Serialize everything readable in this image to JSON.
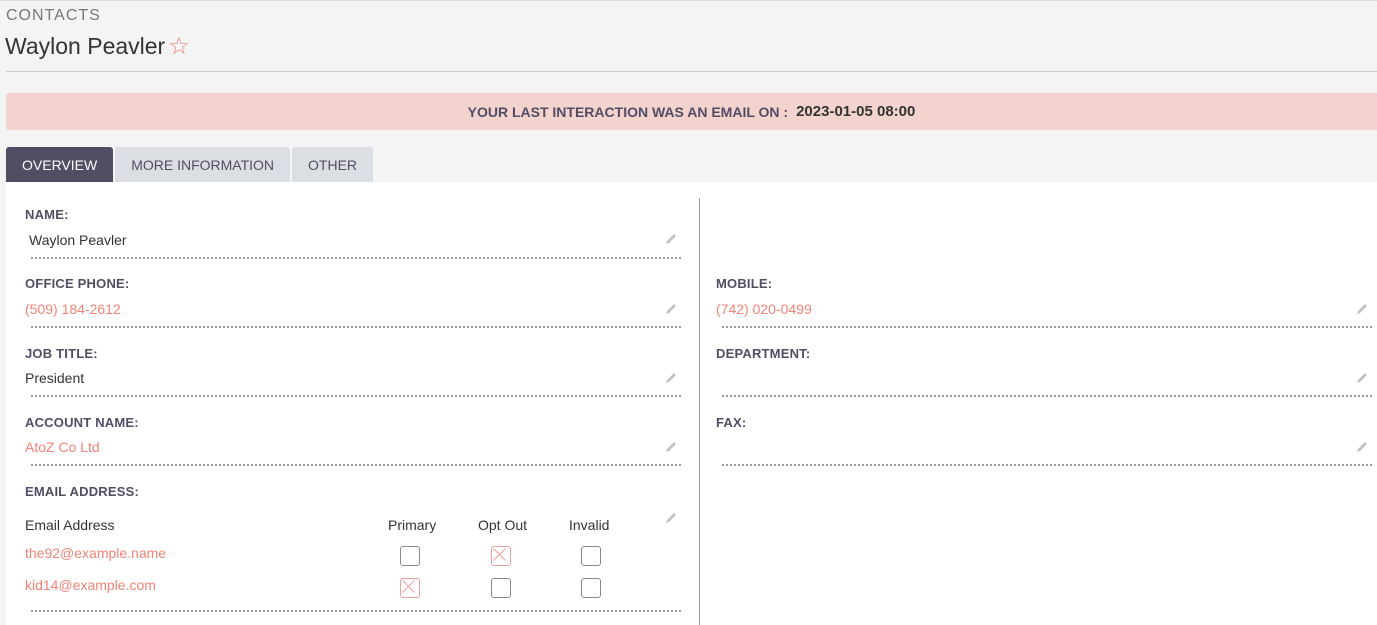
{
  "header": {
    "module": "CONTACTS",
    "record_name": "Waylon Peavler",
    "favorite_icon": "star-outline-icon"
  },
  "banner": {
    "text": "YOUR LAST INTERACTION WAS AN EMAIL ON :",
    "timestamp": "2023-01-05 08:00"
  },
  "tabs": [
    {
      "label": "OVERVIEW",
      "active": true
    },
    {
      "label": "MORE INFORMATION",
      "active": false
    },
    {
      "label": "OTHER",
      "active": false
    }
  ],
  "fields": {
    "name": {
      "label": "NAME:",
      "value": "Waylon Peavler"
    },
    "office_phone": {
      "label": "OFFICE PHONE:",
      "value": "(509) 184-2612"
    },
    "mobile": {
      "label": "MOBILE:",
      "value": "(742) 020-0499"
    },
    "job_title": {
      "label": "JOB TITLE:",
      "value": "President"
    },
    "department": {
      "label": "DEPARTMENT:",
      "value": ""
    },
    "account_name": {
      "label": "ACCOUNT NAME:",
      "value": "AtoZ Co Ltd"
    },
    "fax": {
      "label": "FAX:",
      "value": ""
    },
    "email": {
      "label": "EMAIL ADDRESS:",
      "columns": [
        "Email Address",
        "Primary",
        "Opt Out",
        "Invalid"
      ],
      "rows": [
        {
          "address": "the92@example.name",
          "primary": false,
          "opt_out": true,
          "invalid": false
        },
        {
          "address": "kid14@example.com",
          "primary": true,
          "opt_out": false,
          "invalid": false
        }
      ]
    }
  },
  "colors": {
    "accent": "#534d64",
    "link": "#f08377",
    "banner_bg": "#f2d3cd"
  }
}
